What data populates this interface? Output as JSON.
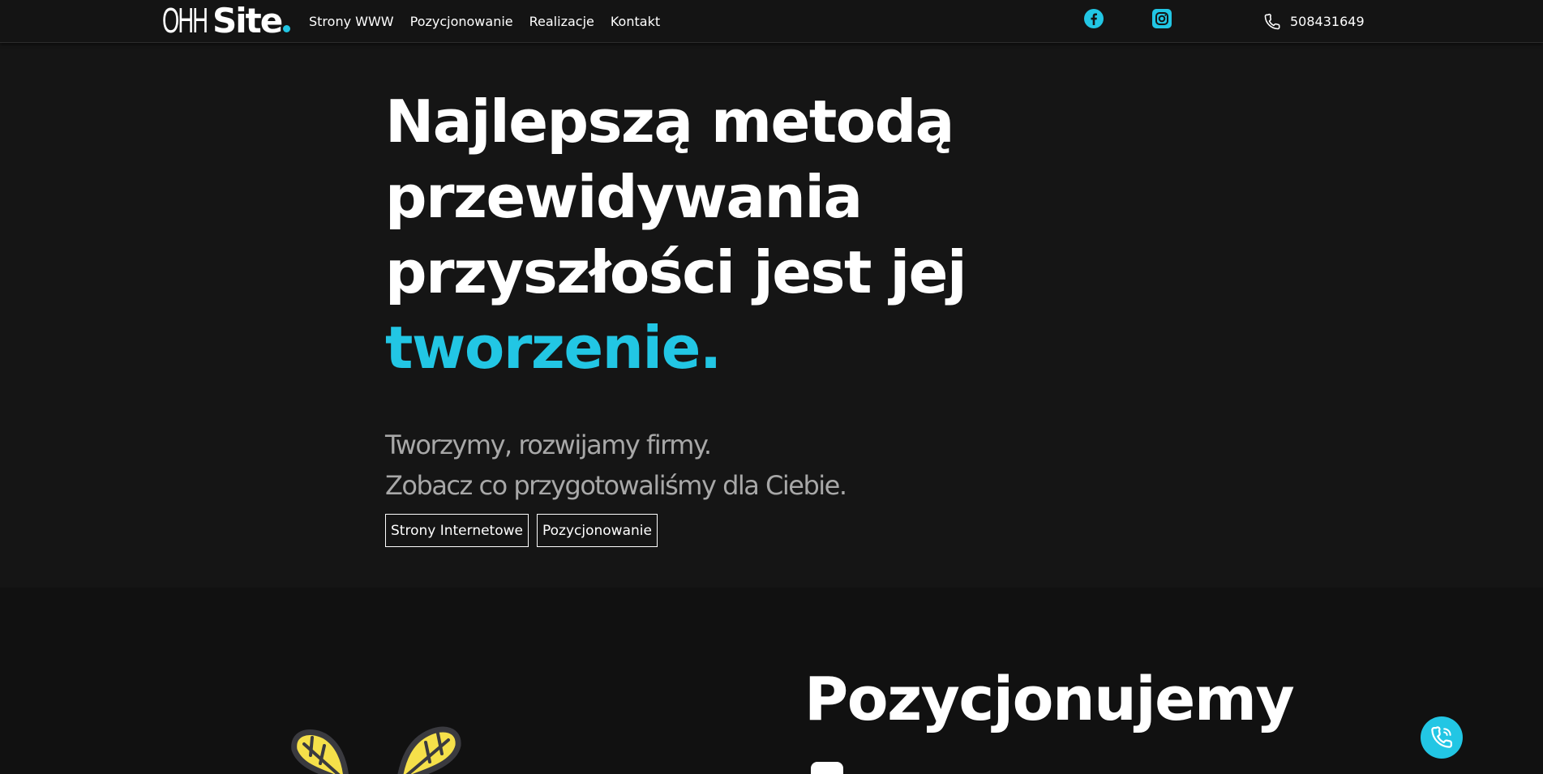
{
  "header": {
    "logo": {
      "part1": "OHH",
      "part2": "Site"
    },
    "nav": [
      {
        "label": "Strony WWW"
      },
      {
        "label": "Pozycjonowanie"
      },
      {
        "label": "Realizacje"
      },
      {
        "label": "Kontakt"
      }
    ],
    "social": {
      "facebook_icon": "facebook-icon",
      "instagram_icon": "instagram-icon"
    },
    "phone": "508431649"
  },
  "hero": {
    "title_lines": [
      "Najlepszą metodą",
      "przewidywania",
      "przyszłości jest jej"
    ],
    "title_accent": "tworzenie.",
    "subtitle_lines": [
      "Tworzymy, rozwijamy firmy.",
      "Zobacz co przygotowaliśmy dla Ciebie."
    ],
    "buttons": [
      {
        "label": "Strony Internetowe"
      },
      {
        "label": "Pozycjonowanie"
      }
    ]
  },
  "section2": {
    "title": "Pozycjonujemy"
  },
  "colors": {
    "accent": "#22c6e4",
    "background": "#151515",
    "plant": "#f5e04a"
  },
  "fab": {
    "icon": "phone-icon"
  }
}
